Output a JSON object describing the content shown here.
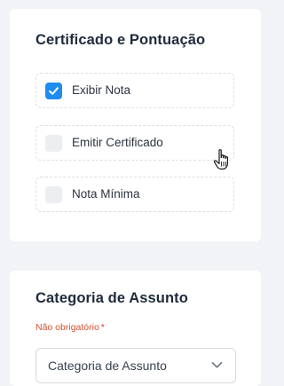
{
  "certificate_card": {
    "title": "Certificado e Pontuação",
    "options": [
      {
        "label": "Exibir Nota",
        "checked": true
      },
      {
        "label": "Emitir Certificado",
        "checked": false
      },
      {
        "label": "Nota Mínima",
        "checked": false
      }
    ]
  },
  "category_card": {
    "title": "Categoria de Assunto",
    "hint": "Não obrigatório",
    "required_mark": "*",
    "select_value": "Categoria de Assunto"
  },
  "colors": {
    "accent": "#1e8cf0",
    "hint": "#d6502b",
    "required": "#e53935"
  },
  "icons": {
    "checkbox_checked": "checkmark-icon",
    "cursor": "hand-pointer-icon",
    "dropdown": "chevron-down-icon"
  }
}
